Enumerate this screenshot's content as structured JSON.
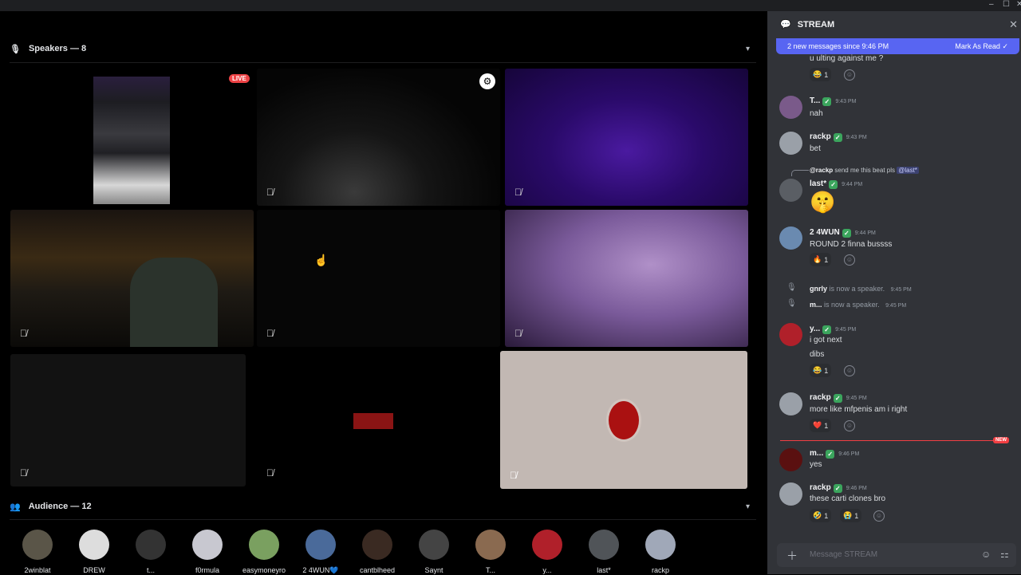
{
  "window": {
    "minimize": "–",
    "maximize": "☐",
    "close": "✕"
  },
  "speakers": {
    "title": "Speakers — 8",
    "live": "LIVE"
  },
  "audience": {
    "title": "Audience — 12",
    "members": [
      "2winblat",
      "DREW",
      "t...",
      "f0rmula",
      "easymoneyro",
      "2 4WUN💙",
      "cantblheed",
      "Saynt",
      "T...",
      "y...",
      "last*",
      "rackp"
    ]
  },
  "chat": {
    "channel": "STREAM",
    "new_banner": "2 new messages since 9:46 PM",
    "mark_read": "Mark As Read",
    "new_tag": "NEW",
    "composer_placeholder": "Message STREAM",
    "top_text": "u ulting against me ?",
    "top_reaction": {
      "emoji": "😂",
      "count": "1"
    },
    "m1": {
      "author": "T...",
      "time": "9:43 PM",
      "text": "nah"
    },
    "m2": {
      "author": "rackp",
      "time": "9:43 PM",
      "text": "bet"
    },
    "m3": {
      "reply_author": "@rackp",
      "reply_text": "send me this beat pls",
      "reply_mention": "@last*",
      "author": "last*",
      "time": "9:44 PM",
      "emoji": "🤫"
    },
    "m4": {
      "author": "2 4WUN",
      "time": "9:44 PM",
      "text": "ROUND 2 finna bussss",
      "reaction": {
        "emoji": "🔥",
        "count": "1"
      }
    },
    "s1": {
      "user": "gnrly",
      "text": "is now a speaker.",
      "time": "9:45 PM"
    },
    "s2": {
      "user": "m...",
      "text": "is now a speaker.",
      "time": "9:45 PM"
    },
    "m5": {
      "author": "y...",
      "time": "9:45 PM",
      "text": "i got next",
      "text2": "dibs",
      "reaction": {
        "emoji": "😂",
        "count": "1"
      }
    },
    "m6": {
      "author": "rackp",
      "time": "9:45 PM",
      "text": "more like mfpenis am i right",
      "reaction": {
        "emoji": "❤️",
        "count": "1"
      }
    },
    "m7": {
      "author": "m...",
      "time": "9:46 PM",
      "text": "yes"
    },
    "m8": {
      "author": "rackp",
      "time": "9:46 PM",
      "text": "these carti clones bro",
      "reaction1": {
        "emoji": "🤣",
        "count": "1"
      },
      "reaction2": {
        "emoji": "😭",
        "count": "1"
      }
    }
  }
}
